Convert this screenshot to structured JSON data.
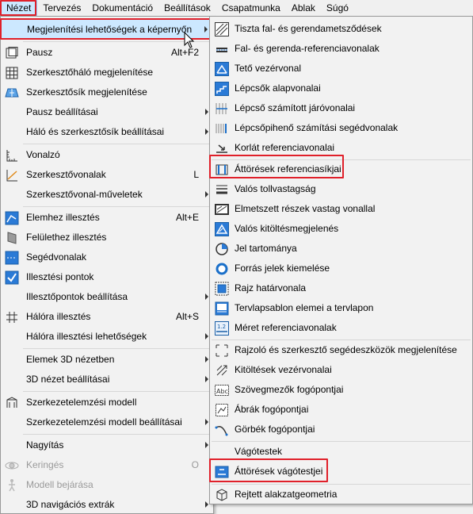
{
  "menubar": {
    "items": [
      "Nézet",
      "Tervezés",
      "Dokumentáció",
      "Beállítások",
      "Csapatmunka",
      "Ablak",
      "Súgó"
    ]
  },
  "main_menu": {
    "items": [
      {
        "label": "Megjelenítési lehetőségek a képernyőn",
        "shortcut": "",
        "submenu": true,
        "icon": "none",
        "highlighted": true
      },
      {
        "label": "Pausz",
        "shortcut": "Alt+F2",
        "icon": "pausz-icon"
      },
      {
        "label": "Szerkesztőháló megjelenítése",
        "shortcut": "",
        "icon": "grid-icon"
      },
      {
        "label": "Szerkesztősík megjelenítése",
        "shortcut": "",
        "icon": "plane-icon"
      },
      {
        "label": "Pausz beállításai",
        "shortcut": "",
        "submenu": true
      },
      {
        "label": "Háló és szerkesztősík beállításai",
        "shortcut": "",
        "submenu": true
      },
      {
        "label": "Vonalzó",
        "shortcut": "",
        "icon": "ruler-icon"
      },
      {
        "label": "Szerkesztővonalak",
        "shortcut": "L",
        "icon": "guideline-icon"
      },
      {
        "label": "Szerkesztővonal-műveletek",
        "shortcut": "",
        "submenu": true
      },
      {
        "label": "Elemhez illesztés",
        "shortcut": "Alt+E",
        "icon": "snap-element-icon"
      },
      {
        "label": "Felülethez illesztés",
        "shortcut": "",
        "icon": "snap-surface-icon"
      },
      {
        "label": "Segédvonalak",
        "shortcut": "",
        "icon": "helper-lines-icon"
      },
      {
        "label": "Illesztési pontok",
        "shortcut": "",
        "icon": "snap-points-icon"
      },
      {
        "label": "Illesztőpontok beállítása",
        "shortcut": "",
        "submenu": true
      },
      {
        "label": "Hálóra illesztés",
        "shortcut": "Alt+S",
        "icon": "grid-snap-icon"
      },
      {
        "label": "Hálóra illesztési lehetőségek",
        "shortcut": "",
        "submenu": true
      },
      {
        "label": "Elemek 3D nézetben",
        "shortcut": "",
        "submenu": true
      },
      {
        "label": "3D nézet beállításai",
        "shortcut": "",
        "submenu": true
      },
      {
        "label": "Szerkezetelemzési modell",
        "shortcut": "",
        "icon": "structural-model-icon"
      },
      {
        "label": "Szerkezetelemzési modell beállításai",
        "shortcut": "",
        "submenu": true
      },
      {
        "label": "Nagyítás",
        "shortcut": "",
        "submenu": true
      },
      {
        "label": "Keringés",
        "shortcut": "O",
        "icon": "orbit-icon",
        "disabled": true
      },
      {
        "label": "Modell bejárása",
        "shortcut": "",
        "icon": "walk-icon",
        "disabled": true
      },
      {
        "label": "3D navigációs extrák",
        "shortcut": "",
        "submenu": true
      }
    ]
  },
  "sub_menu": {
    "items": [
      {
        "label": "Tiszta fal- és gerendametsződések",
        "icon": "clean-intersections-icon"
      },
      {
        "label": "Fal- és gerenda-referenciavonalak",
        "icon": "reference-lines-icon"
      },
      {
        "label": "Tető vezérvonal",
        "icon": "roof-pivot-icon"
      },
      {
        "label": "Lépcsők alapvonalai",
        "icon": "stair-baseline-icon"
      },
      {
        "label": "Lépcső számított járóvonalai",
        "icon": "stair-walkline-icon"
      },
      {
        "label": "Lépcsőpihenő számítási segédvonalak",
        "icon": "landing-lines-icon"
      },
      {
        "label": "Korlát referenciavonalai",
        "icon": "railing-reference-icon"
      },
      {
        "label": "Áttörések referenciasíkjai",
        "icon": "opening-reference-icon",
        "boxed": true
      },
      {
        "label": "Valós tollvastagság",
        "icon": "pen-weight-icon"
      },
      {
        "label": "Elmetszett részek vastag vonallal",
        "icon": "bold-cut-lines-icon"
      },
      {
        "label": "Valós kitöltésmegjelenés",
        "icon": "fill-display-icon"
      },
      {
        "label": "Jel tartománya",
        "icon": "marker-range-icon"
      },
      {
        "label": "Forrás jelek kiemelése",
        "icon": "source-markers-icon"
      },
      {
        "label": "Rajz határvonala",
        "icon": "drawing-frame-icon"
      },
      {
        "label": "Tervlapsablon elemei a tervlapon",
        "icon": "master-layout-icon"
      },
      {
        "label": "Méret referenciavonalak",
        "icon": "dimension-reference-icon"
      },
      {
        "label": "Rajzoló és szerkesztő segédeszközök megjelenítése",
        "icon": "drafting-aids-icon"
      },
      {
        "label": "Kitöltések vezérvonalai",
        "icon": "fill-handles-icon"
      },
      {
        "label": "Szövegmezők fogópontjai",
        "icon": "text-handles-icon"
      },
      {
        "label": "Ábrák fogópontjai",
        "icon": "figure-handles-icon"
      },
      {
        "label": "Görbék fogópontjai",
        "icon": "curve-handles-icon"
      },
      {
        "label": "Vágótestek",
        "icon": "cutting-bodies-icon"
      },
      {
        "label": "Áttörések vágótestjei",
        "icon": "opening-cutting-bodies-icon",
        "boxed": true
      },
      {
        "label": "Rejtett alakzatgeometria",
        "icon": "hidden-geometry-icon"
      }
    ]
  },
  "colors": {
    "highlight_bg": "#cce8ff",
    "highlight_border": "#99d1ff",
    "annotation_red": "#e0202a",
    "icon_blue": "#1a6fc9"
  }
}
